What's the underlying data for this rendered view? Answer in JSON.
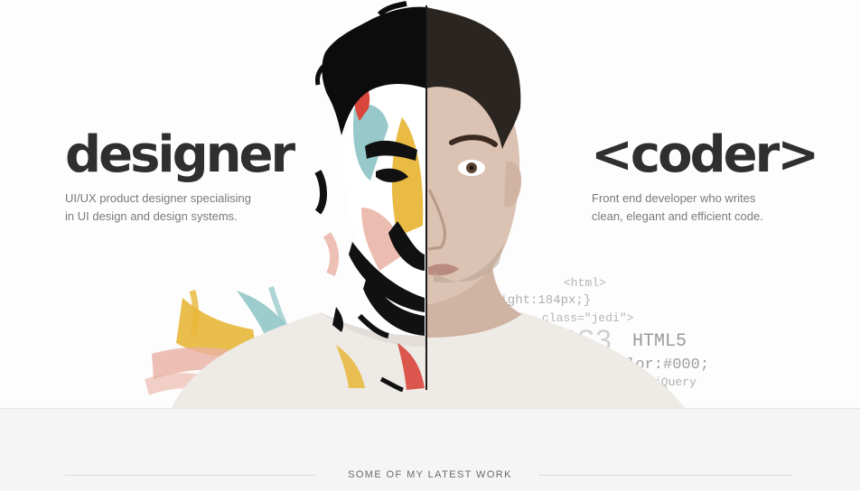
{
  "hero": {
    "left_title": "designer",
    "left_description_line1": "UI/UX product designer specialising",
    "left_description_line2": "in UI design and design systems.",
    "right_title": "<coder>",
    "right_description_line1": "Front end developer who writes",
    "right_description_line2": "clean, elegant and efficient code.",
    "code_snippets": {
      "html_tag": "<html>",
      "height": "eight:184px;}",
      "class": "class=\"jedi\">",
      "css3": "SS3",
      "html5": "HTML5",
      "color": "olor:#000;",
      "jquery": "jQuery"
    }
  },
  "latest_work": {
    "heading": "SOME OF MY LATEST WORK"
  },
  "colors": {
    "title": "#2f2f2f",
    "description": "#7a7a7a",
    "code_text": "#9a9a9a",
    "paint_red": "#d8463c",
    "paint_yellow": "#e8b73a",
    "paint_teal": "#8cc3c4",
    "paint_pink": "#eab0a3",
    "shirt": "#eeeae6",
    "skin": "#d9c0b0"
  }
}
